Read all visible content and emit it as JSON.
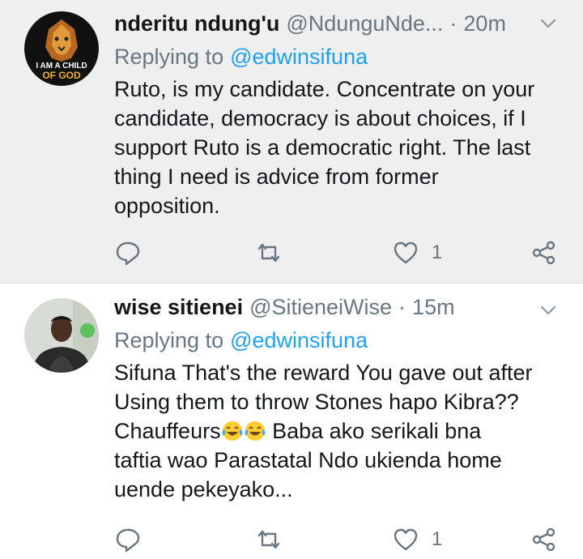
{
  "tweets": [
    {
      "display_name": "nderitu ndung'u",
      "handle": "@NdunguNde...",
      "separator": "·",
      "time": "20m",
      "replying_prefix": "Replying to",
      "replying_to": "@edwinsifuna",
      "text_lines": [
        "Ruto, is my candidate. Concentrate on your",
        "candidate, democracy is about choices, if I",
        "support Ruto is a democratic right. The last",
        "thing I need is advice from former",
        "opposition."
      ],
      "avatar_text_1": "I AM A CHILD",
      "avatar_text_2": "OF GOD",
      "like_count": "1"
    },
    {
      "display_name": "wise sitienei",
      "handle": "@SitieneiWise",
      "separator": "·",
      "time": "15m",
      "replying_prefix": "Replying to",
      "replying_to": "@edwinsifuna",
      "text_line_1": "Sifuna That's the reward You gave out after",
      "text_line_2": "Using them to throw Stones hapo Kibra??",
      "text_line_3_start": "Chauffeurs",
      "text_line_3_end": " Baba ako serikali bna",
      "text_line_4": "taftia wao Parastatal Ndo ukienda home",
      "text_line_5": "uende pekeyako...",
      "like_count": "1"
    }
  ],
  "icons": [
    "chevron-down-icon",
    "reply-icon",
    "retweet-icon",
    "heart-icon",
    "share-icon",
    "tears-of-joy-emoji"
  ],
  "colors": {
    "text_primary": "#14171a",
    "text_secondary": "#687782",
    "link": "#1da1f2",
    "highlight_background": "#efefef"
  }
}
